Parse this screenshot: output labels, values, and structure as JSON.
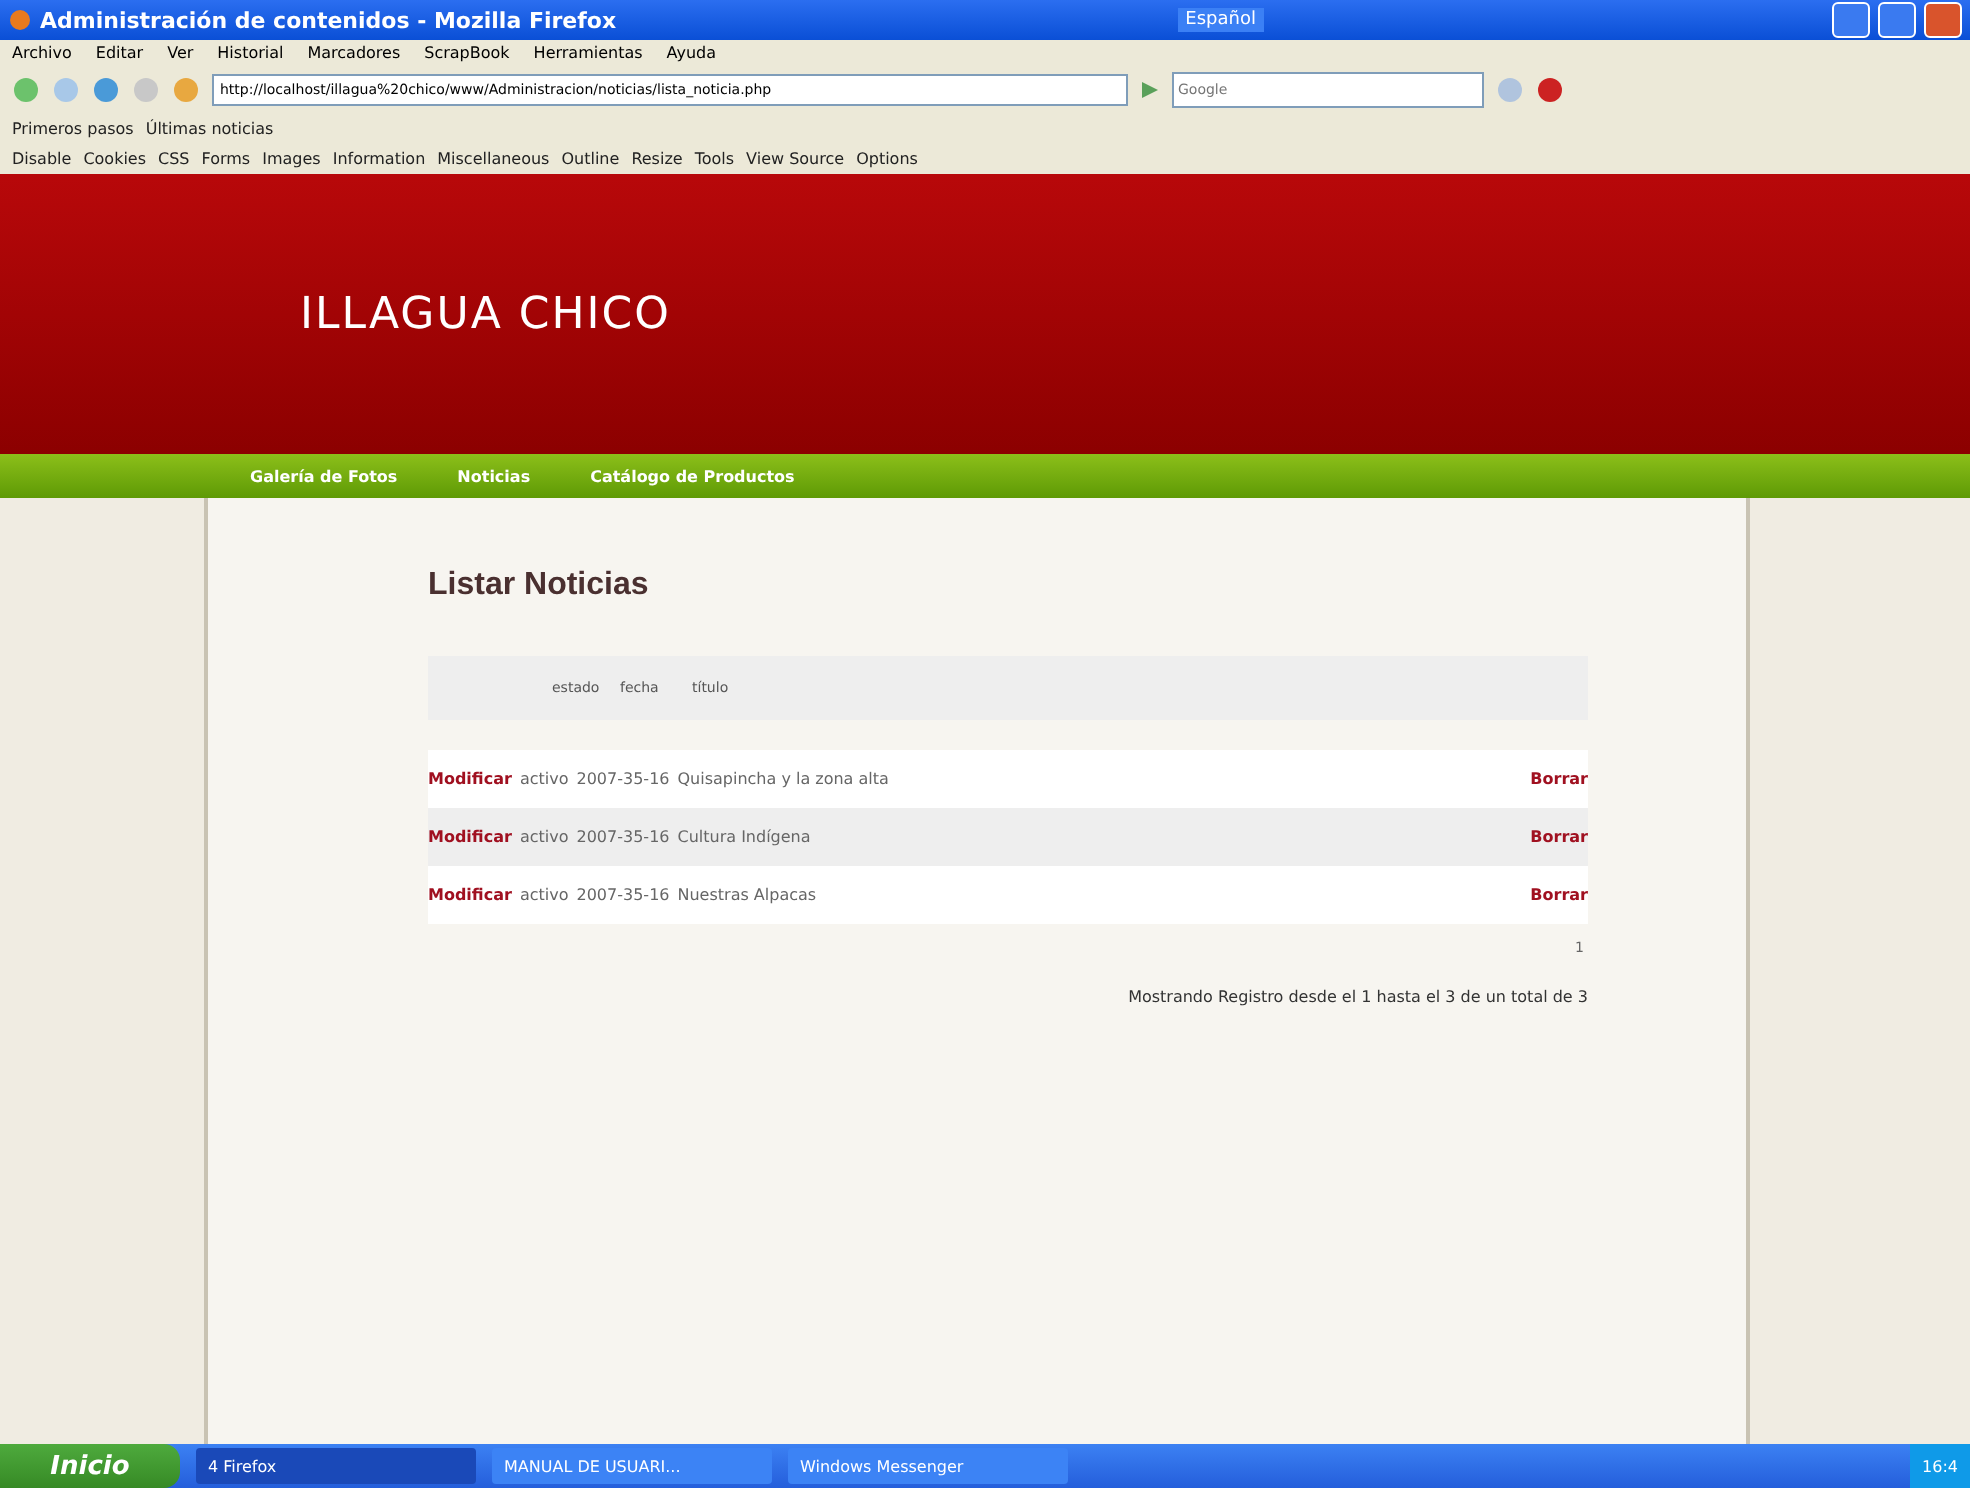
{
  "window": {
    "title": "Administración de contenidos - Mozilla Firefox",
    "language": "Español"
  },
  "menu": [
    "Archivo",
    "Editar",
    "Ver",
    "Historial",
    "Marcadores",
    "ScrapBook",
    "Herramientas",
    "Ayuda"
  ],
  "address": {
    "value": "http://localhost/illagua%20chico/www/Administracion/noticias/lista_noticia.php"
  },
  "search": {
    "placeholder": "Google"
  },
  "bookmarks": [
    "Primeros pasos",
    "Últimas noticias"
  ],
  "devtools": [
    "Disable",
    "Cookies",
    "CSS",
    "Forms",
    "Images",
    "Information",
    "Miscellaneous",
    "Outline",
    "Resize",
    "Tools",
    "View Source",
    "Options"
  ],
  "site": {
    "title": "ILLAGUA CHICO",
    "nav": [
      "Galería de Fotos",
      "Noticias",
      "Catálogo de Productos"
    ]
  },
  "heading": "Listar Noticias",
  "table": {
    "columns": [
      "estado",
      "fecha",
      "título"
    ],
    "rows": [
      {
        "edit": "Modificar",
        "estado": "activo",
        "fecha": "2007-35-16",
        "titulo": "Quisapincha y la zona alta",
        "delete": "Borrar"
      },
      {
        "edit": "Modificar",
        "estado": "activo",
        "fecha": "2007-35-16",
        "titulo": "Cultura Indígena",
        "delete": "Borrar"
      },
      {
        "edit": "Modificar",
        "estado": "activo",
        "fecha": "2007-35-16",
        "titulo": "Nuestras Alpacas",
        "delete": "Borrar"
      }
    ]
  },
  "pages": "1",
  "summary": "Mostrando Registro desde el 1 hasta el 3 de un total de 3",
  "taskbar": {
    "start": "Inicio",
    "tasks": [
      {
        "label": "4 Firefox",
        "selected": true
      },
      {
        "label": "MANUAL DE USUARI...",
        "selected": false
      },
      {
        "label": "Windows Messenger",
        "selected": false
      }
    ],
    "clock": "16:4"
  }
}
